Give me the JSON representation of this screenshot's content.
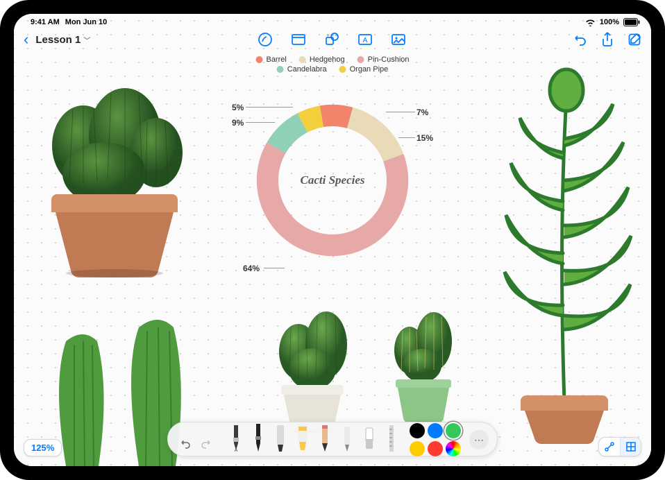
{
  "statusbar": {
    "time": "9:41 AM",
    "date": "Mon Jun 10",
    "battery": "100%"
  },
  "toolbar": {
    "doc_title": "Lesson 1"
  },
  "zoom": {
    "level": "125%"
  },
  "chart_data": {
    "type": "pie",
    "title": "Cacti Species",
    "series": [
      {
        "name": "Barrel",
        "value": 7,
        "color": "#f2846b"
      },
      {
        "name": "Hedgehog",
        "value": 15,
        "color": "#e9dbb8"
      },
      {
        "name": "Pin-Cushion",
        "value": 64,
        "color": "#e6a9a7"
      },
      {
        "name": "Candelabra",
        "value": 9,
        "color": "#8fd0b7"
      },
      {
        "name": "Organ Pipe",
        "value": 5,
        "color": "#f3cf3e"
      }
    ],
    "labels": {
      "l7": "7%",
      "l15": "15%",
      "l64": "64%",
      "l9": "9%",
      "l5": "5%"
    }
  },
  "legend": {
    "row1": [
      {
        "name": "Barrel",
        "color": "#f2846b"
      },
      {
        "name": "Hedgehog",
        "color": "#e9dbb8"
      },
      {
        "name": "Pin-Cushion",
        "color": "#e6a9a7"
      }
    ],
    "row2": [
      {
        "name": "Candelabra",
        "color": "#8fd0b7"
      },
      {
        "name": "Organ Pipe",
        "color": "#f3cf3e"
      }
    ]
  },
  "palette": {
    "colors": [
      "#000000",
      "#007aff",
      "#34c759",
      "#ffcc00",
      "#ff3b30"
    ],
    "selected_index": 2
  }
}
